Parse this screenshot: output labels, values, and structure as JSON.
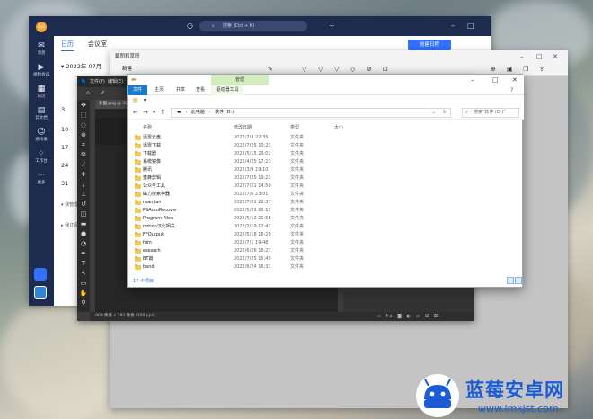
{
  "calendar_app": {
    "avatar_text": "乐乐",
    "search_placeholder": "搜索 (Ctrl + K)",
    "sidebar": [
      {
        "label": "消息",
        "icon": "chat-icon"
      },
      {
        "label": "视频会议",
        "icon": "video-icon"
      },
      {
        "label": "日历",
        "icon": "calendar-icon"
      },
      {
        "label": "云文档",
        "icon": "doc-icon"
      },
      {
        "label": "通讯录",
        "icon": "contacts-icon"
      },
      {
        "label": "工作台",
        "icon": "apps-icon"
      },
      {
        "label": "更多",
        "icon": "more-icon"
      }
    ],
    "tabs": [
      "日历",
      "会议室"
    ],
    "create_button": "创建日程",
    "month_label": "2022年 07月",
    "day_numbers": [
      "3",
      "10",
      "17",
      "24",
      "31"
    ],
    "mini_labels": [
      "我管理",
      "我订阅"
    ]
  },
  "screenshot_window": {
    "title": "截图和草图",
    "new_label": "新建"
  },
  "photoshop": {
    "logo": "Ps",
    "menus": [
      "文件(F)",
      "编辑(E)"
    ],
    "doc_tab": "封面.png @ 30",
    "status_text": "900 像素 x 383 像素 (300 ppi)"
  },
  "explorer": {
    "context_tab": "管理",
    "ribbon_tabs": [
      "文件",
      "主页",
      "共享",
      "查看",
      "驱动器工具"
    ],
    "address": {
      "root": "此电脑",
      "drive": "软件 (D:)"
    },
    "search_placeholder": "搜索\"软件 (D:)\"",
    "columns": {
      "name": "名称",
      "date": "修改日期",
      "type": "类型",
      "size": "大小"
    },
    "files": [
      {
        "name": "迅雷云盘",
        "date": "2022/7/3 22:35",
        "type": "文件夹"
      },
      {
        "name": "迅雷下载",
        "date": "2022/7/25 10:23",
        "type": "文件夹"
      },
      {
        "name": "下载器",
        "date": "2022/5/15 23:02",
        "type": "文件夹"
      },
      {
        "name": "系统镜像",
        "date": "2022/4/25 17:21",
        "type": "文件夹"
      },
      {
        "name": "腾讯",
        "date": "2022/3/9 19:10",
        "type": "文件夹"
      },
      {
        "name": "蜜蜂剪辑",
        "date": "2022/7/25 19:23",
        "type": "文件夹"
      },
      {
        "name": "公众号工具",
        "date": "2022/7/21 14:50",
        "type": "文件夹"
      },
      {
        "name": "磁力搜索神器",
        "date": "2022/7/6 23:01",
        "type": "文件夹"
      },
      {
        "name": "ruanjian",
        "date": "2022/7/21 22:37",
        "type": "文件夹"
      },
      {
        "name": "PSAutoRecover",
        "date": "2022/5/21 20:17",
        "type": "文件夹"
      },
      {
        "name": "Program Files",
        "date": "2022/5/12 21:58",
        "type": "文件夹"
      },
      {
        "name": "notion汉化相关",
        "date": "2022/2/19 12:42",
        "type": "文件夹"
      },
      {
        "name": "FFOutput",
        "date": "2022/5/18 16:20",
        "type": "文件夹"
      },
      {
        "name": "fdm",
        "date": "2022/7/1 19:48",
        "type": "文件夹"
      },
      {
        "name": "esearch",
        "date": "2022/6/26 16:27",
        "type": "文件夹"
      },
      {
        "name": "BT篇",
        "date": "2022/7/25 15:49",
        "type": "文件夹"
      },
      {
        "name": "band",
        "date": "2022/6/24 16:31",
        "type": "文件夹"
      }
    ],
    "status": "17 个项目"
  },
  "watermark": {
    "title": "蓝莓安卓网",
    "url": "www.lmkjst.com"
  },
  "colors": {
    "explorer_file_tab": "#1979ca",
    "context_tab": "#d3ecc0",
    "folder": "#f3c857",
    "calendar_accent": "#3370ff",
    "calendar_dark": "#1d2b4f",
    "watermark": "#1b5cd6"
  }
}
